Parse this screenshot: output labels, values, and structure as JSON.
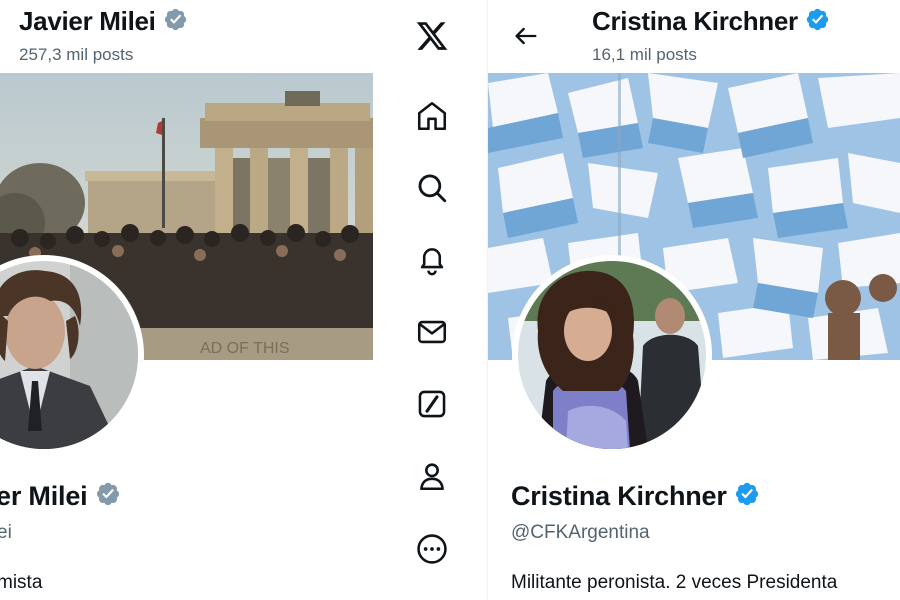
{
  "left_profile": {
    "header_name": "Javier Milei",
    "header_posts": "257,3 mil posts",
    "display_name_partial": "er Milei",
    "handle_partial": "ei",
    "bio_partial": "mista",
    "verified_color": "#829aab"
  },
  "nav": {
    "items": [
      {
        "icon": "x-logo-icon"
      },
      {
        "icon": "home-icon"
      },
      {
        "icon": "search-icon"
      },
      {
        "icon": "bell-icon"
      },
      {
        "icon": "mail-icon"
      },
      {
        "icon": "grok-icon"
      },
      {
        "icon": "profile-icon"
      },
      {
        "icon": "more-icon"
      }
    ]
  },
  "right_profile": {
    "header_name": "Cristina Kirchner",
    "header_posts": "16,1 mil posts",
    "display_name": "Cristina Kirchner",
    "handle": "@CFKArgentina",
    "bio": "Militante peronista. 2 veces Presidenta",
    "verified_color": "#1d9bf0"
  }
}
